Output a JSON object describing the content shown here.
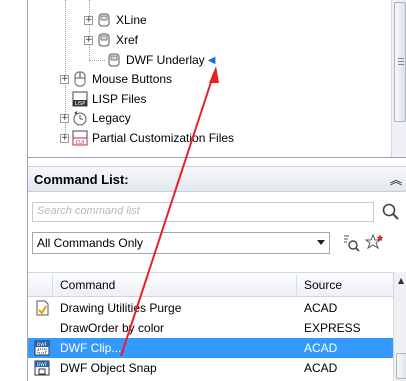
{
  "tree": {
    "items": [
      {
        "label": "XLine",
        "expander": "+",
        "icon": "toolbar-icon"
      },
      {
        "label": "Xref",
        "expander": "+",
        "icon": "toolbar-icon"
      },
      {
        "label": "DWF Underlay",
        "expander": "",
        "icon": "toolbar-icon"
      },
      {
        "label": "Mouse Buttons",
        "expander": "+",
        "icon": "mouse-icon"
      },
      {
        "label": "LISP Files",
        "expander": "",
        "icon": "lisp-file-icon"
      },
      {
        "label": "Legacy",
        "expander": "+",
        "icon": "legacy-icon"
      },
      {
        "label": "Partial Customization Files",
        "expander": "+",
        "icon": "cui-file-icon"
      }
    ],
    "lisp_icon_text": "LISP",
    "cui_icon_text": "CUI"
  },
  "command_list": {
    "title": "Command List:",
    "search_placeholder": "Search command list",
    "filter_value": "All Commands Only",
    "columns": {
      "command": "Command",
      "source": "Source"
    },
    "rows": [
      {
        "command": "Drawing Utilities Purge",
        "source": "ACAD",
        "icon": "purge-icon",
        "selected": false
      },
      {
        "command": "DrawOrder by color",
        "source": "EXPRESS",
        "icon": "",
        "selected": false
      },
      {
        "command": "DWF Clip...",
        "source": "ACAD",
        "icon": "dwf-clip-icon",
        "selected": true
      },
      {
        "command": "DWF Object Snap",
        "source": "ACAD",
        "icon": "dwf-snap-icon",
        "selected": false
      }
    ],
    "dwf_icon_text": "DWF"
  },
  "colors": {
    "selection": "#3399ff",
    "annotation_arrow": "#e8202a",
    "marker": "#1a72d6"
  }
}
